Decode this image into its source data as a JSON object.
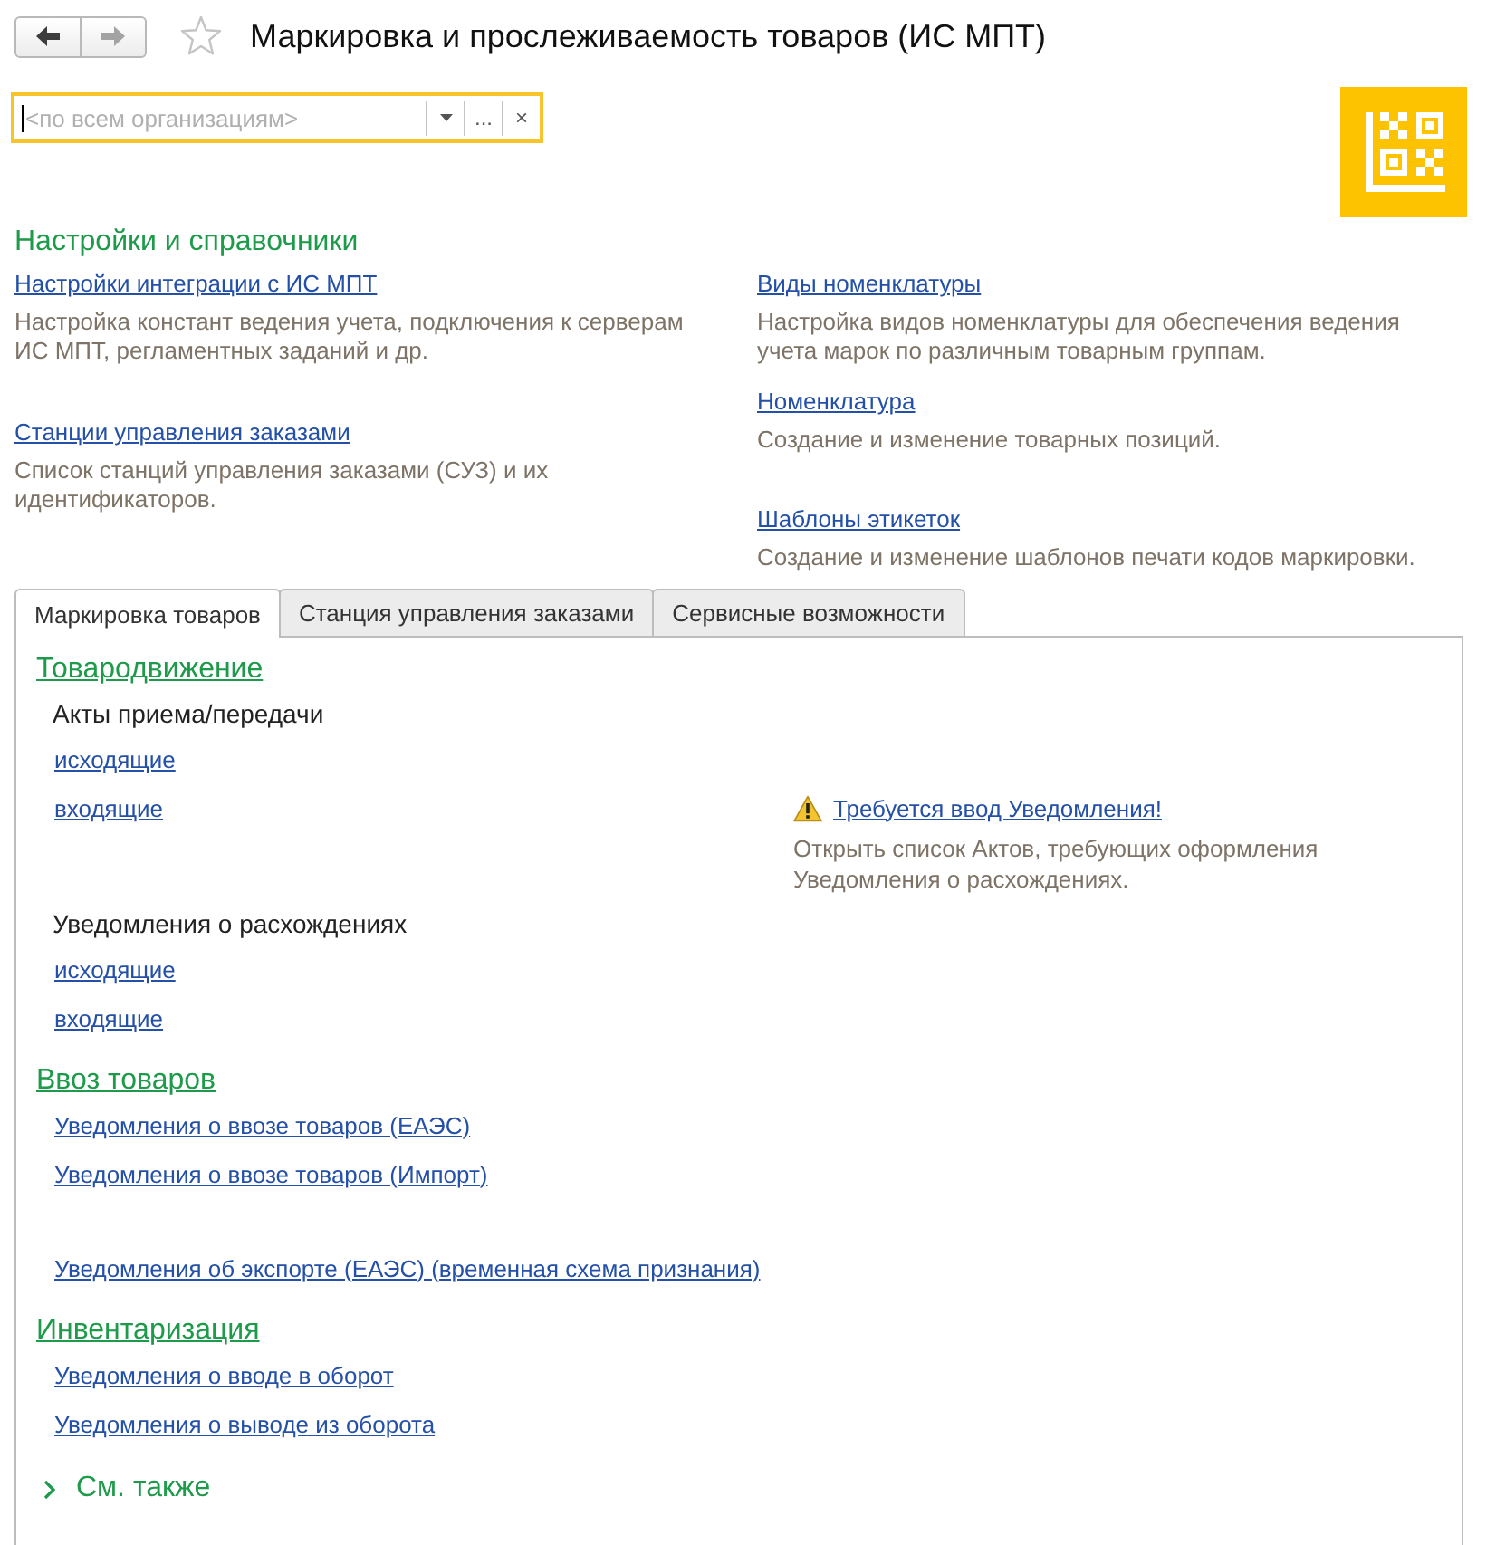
{
  "nav": [
    {
      "kind": "back",
      "disabled": false
    },
    {
      "kind": "forward",
      "disabled": true
    }
  ],
  "favorite": false,
  "title": "Маркировка и прослеживаемость товаров (ИС МПТ)",
  "organization_field": {
    "placeholder": "<по всем организациям>",
    "focused": true,
    "buttons": [
      {
        "kind": "dropdown"
      },
      {
        "kind": "select",
        "label": "..."
      },
      {
        "kind": "clear",
        "label": "×"
      }
    ]
  },
  "settings": {
    "title": "Настройки и справочники",
    "columns": [
      [
        {
          "link": "Настройки интеграции с ИС МПТ",
          "description": "Настройка констант ведения учета, подключения к серверам ИС МПТ, регламентных заданий и др."
        },
        {
          "link": "Станции управления заказами",
          "description": "Список станций управления заказами (СУЗ) и их идентификаторов."
        }
      ],
      [
        {
          "link": "Виды номенклатуры",
          "description": "Настройка видов номенклатуры для обеспечения ведения учета марок по различным товарным группам."
        },
        {
          "link": "Номенклатура",
          "description": "Создание и изменение товарных позиций."
        },
        {
          "link": "Шаблоны этикеток",
          "description": "Создание и изменение шаблонов печати кодов маркировки."
        }
      ]
    ]
  },
  "tabs": [
    {
      "label": "Маркировка товаров",
      "selected": true
    },
    {
      "label": "Станция управления заказами",
      "selected": false
    },
    {
      "label": "Сервисные возможности",
      "selected": false
    }
  ],
  "sections": [
    {
      "title": "Товародвижение",
      "groups": [
        {
          "title": "Акты приема/передачи",
          "links": [
            "исходящие",
            "входящие"
          ],
          "notice": {
            "link": "Требуется ввод Уведомления!",
            "description": "Открыть список Актов, требующих оформления Уведомления о расхождениях."
          }
        },
        {
          "title": "Уведомления о расхождениях",
          "links": [
            "исходящие",
            "входящие"
          ]
        }
      ]
    },
    {
      "title": "Ввоз товаров",
      "groups": [
        {
          "links": [
            "Уведомления о ввозе товаров (ЕАЭС)",
            "Уведомления о ввозе товаров (Импорт)"
          ]
        },
        {
          "links": [
            "Уведомления об экспорте (ЕАЭС) (временная схема признания)"
          ]
        }
      ]
    },
    {
      "title": "Инвентаризация",
      "groups": [
        {
          "links": [
            "Уведомления о вводе в оборот",
            "Уведомления о выводе из оборота"
          ]
        }
      ]
    }
  ],
  "see_also": {
    "label": "См. также",
    "expanded": false
  }
}
